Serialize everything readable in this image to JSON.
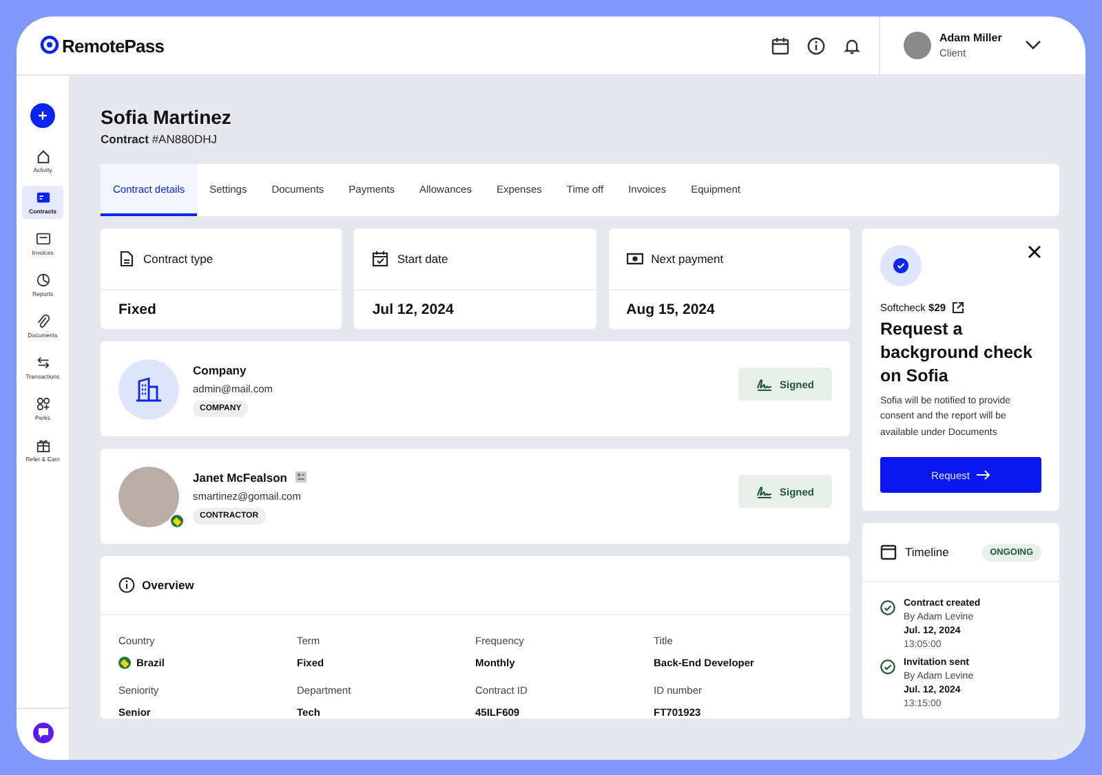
{
  "header": {
    "logo": "RemotePass",
    "user": {
      "name": "Adam Miller",
      "role": "Client"
    }
  },
  "sidebar": {
    "items": [
      {
        "kind": "activity",
        "label": "Activity",
        "selected": false
      },
      {
        "kind": "contracts",
        "label": "Contracts",
        "selected": true
      },
      {
        "kind": "invoices",
        "label": "Invoices",
        "selected": false
      },
      {
        "kind": "reports",
        "label": "Reports",
        "selected": false
      },
      {
        "kind": "documents",
        "label": "Documents",
        "selected": false
      },
      {
        "kind": "transactions",
        "label": "Transactions",
        "selected": false
      },
      {
        "kind": "perks",
        "label": "Perks",
        "selected": false
      },
      {
        "kind": "refer",
        "label": "Refer & Earn",
        "selected": false
      }
    ]
  },
  "contract": {
    "name": "Sofia Martinez",
    "subtitle": "**Contract** #AN880DHJ"
  },
  "tabs": [
    {
      "label": "Contract details",
      "selected": true
    },
    {
      "label": "Settings",
      "selected": false
    },
    {
      "label": "Documents",
      "selected": false
    },
    {
      "label": "Payments",
      "selected": false
    },
    {
      "label": "Allowances",
      "selected": false
    },
    {
      "label": "Expenses",
      "selected": false
    },
    {
      "label": "Time off",
      "selected": false
    },
    {
      "label": "Invoices",
      "selected": false
    },
    {
      "label": "Equipment",
      "selected": false
    }
  ],
  "summary": [
    {
      "kind": "document",
      "label": "Contract type",
      "value": "Fixed"
    },
    {
      "kind": "calendar",
      "label": "Start date",
      "value": "Jul 12, 2024"
    },
    {
      "kind": "money",
      "label": "Next payment",
      "value": "Aug 15, 2024"
    }
  ],
  "parties": [
    {
      "kind": "company",
      "name": "Company",
      "email": "admin@mail.com",
      "tag": "COMPANY",
      "status": "Signed"
    },
    {
      "kind": "contractor",
      "name": "Janet McFealson",
      "email": "smartinez@gomail.com",
      "tag": "CONTRACTOR",
      "status": "Signed"
    }
  ],
  "overview": {
    "title": "Overview",
    "fields": [
      {
        "kind": "country",
        "label": "Country",
        "value": "Brazil"
      },
      {
        "kind": "text",
        "label": "Term",
        "value": "Fixed"
      },
      {
        "kind": "text",
        "label": "Frequency",
        "value": "Monthly"
      },
      {
        "kind": "text",
        "label": "Title",
        "value": "Back-End Developer"
      },
      {
        "kind": "text",
        "label": "Seniority",
        "value": "Senior"
      },
      {
        "kind": "text",
        "label": "Department",
        "value": "Tech"
      },
      {
        "kind": "text",
        "label": "Contract ID",
        "value": "45ILF609"
      },
      {
        "kind": "text",
        "label": "ID number",
        "value": "FT701923"
      }
    ]
  },
  "promo": {
    "provider": "Softcheck **$29**",
    "title": "Request a background check on Sofia",
    "text": "Sofia will be notified to provide consent and the report will be available under Documents",
    "button": "Request"
  },
  "timeline": {
    "title": "Timeline",
    "status": "ONGOING",
    "events": [
      {
        "title": "Contract created",
        "by": "By Adam Levine",
        "date": "Jul. 12, 2024",
        "time": "13:05:00",
        "done": true
      },
      {
        "title": "Invitation sent",
        "by": "By Adam Levine",
        "date": "Jul. 12, 2024",
        "time": "13:15:00",
        "done": true
      }
    ]
  }
}
